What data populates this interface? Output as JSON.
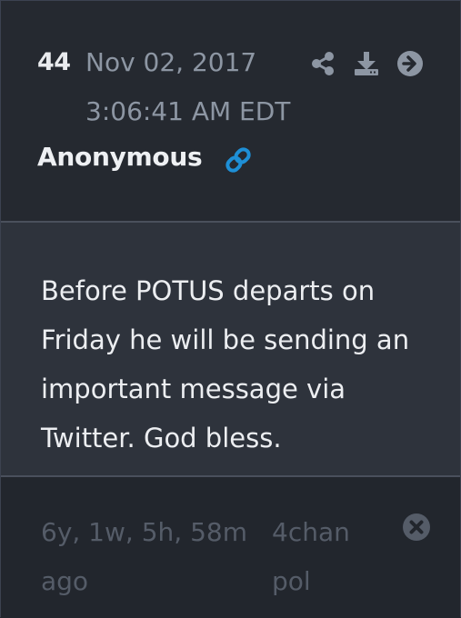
{
  "post": {
    "number": "44",
    "date": "Nov 02, 2017",
    "time": "3:06:41 AM EDT",
    "author": "Anonymous",
    "message": "Before POTUS departs on Friday he will be sending an important message via Twitter. God bless.",
    "age": "6y, 1w, 5h, 58m ago",
    "source_site": "4chan",
    "source_board": "pol"
  },
  "icons": {
    "share": "share-icon",
    "download": "download-icon",
    "open": "arrow-circle-right-icon",
    "link": "link-icon",
    "close": "close-circle-icon"
  },
  "colors": {
    "header_bg": "#252930",
    "body_bg": "#2e333c",
    "footer_bg": "#22262d",
    "muted_text": "#8d96a3",
    "link_accent": "#1e8fd6",
    "faded_text": "#555c68"
  }
}
